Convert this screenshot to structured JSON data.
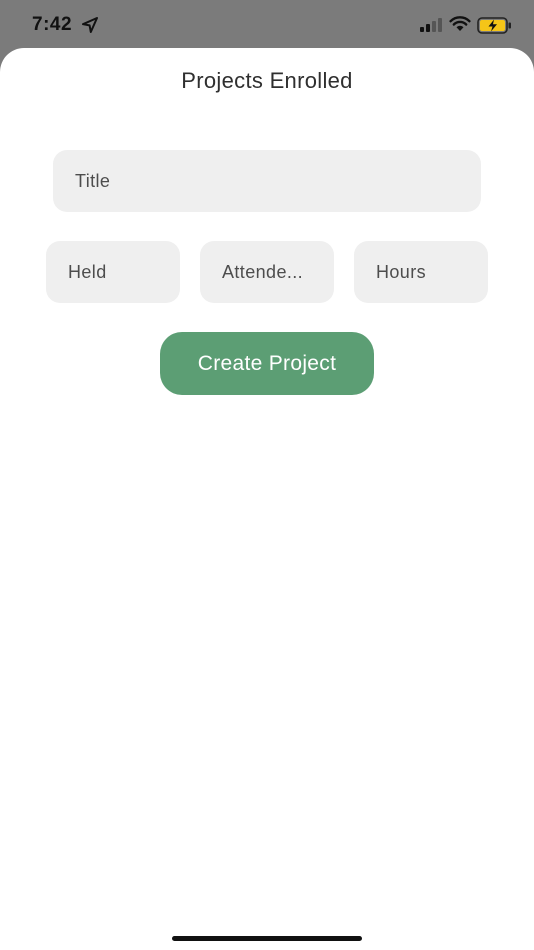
{
  "status_bar": {
    "time": "7:42",
    "icons": [
      "location-arrow-icon",
      "cellular-signal-icon",
      "wifi-icon",
      "battery-charging-icon"
    ]
  },
  "sheet": {
    "title": "Projects Enrolled"
  },
  "form": {
    "title_placeholder": "Title",
    "held_placeholder": "Held",
    "attended_placeholder": "Attende...",
    "hours_placeholder": "Hours",
    "create_label": "Create Project"
  },
  "colors": {
    "accent": "#5c9e74",
    "field_bg": "#efefef",
    "backdrop": "#7b7b7b"
  }
}
